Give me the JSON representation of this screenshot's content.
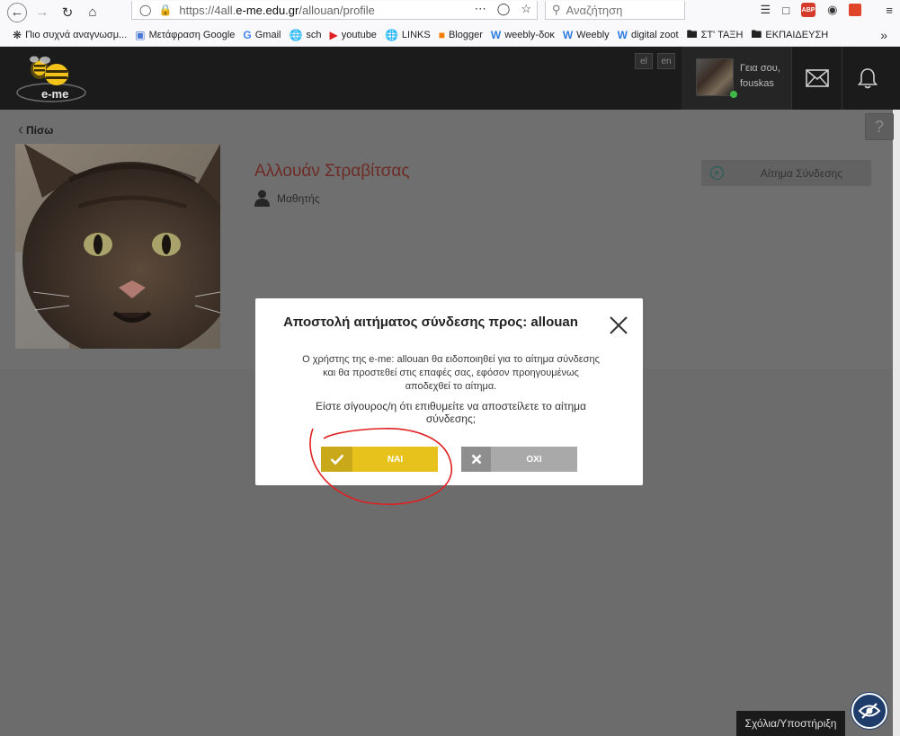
{
  "browser": {
    "url_prefix": "https://4all.",
    "url_domain": "e-me.edu.gr",
    "url_path": "/allouan/profile",
    "search_placeholder": "Αναζήτηση",
    "abp_label": "ABP"
  },
  "bookmarks": [
    {
      "label": "Πιο συχνά αναγνωσμ...",
      "icon": "gear-icon"
    },
    {
      "label": "Μετάφραση Google",
      "icon": "translate-icon"
    },
    {
      "label": "Gmail",
      "icon": "google-icon"
    },
    {
      "label": "sch",
      "icon": "globe-icon"
    },
    {
      "label": "youtube",
      "icon": "youtube-icon"
    },
    {
      "label": "LINKS",
      "icon": "globe-icon"
    },
    {
      "label": "Blogger",
      "icon": "blogger-icon"
    },
    {
      "label": "weebly-δοκ",
      "icon": "weebly-icon"
    },
    {
      "label": "Weebly",
      "icon": "weebly-icon"
    },
    {
      "label": "digital zoot",
      "icon": "weebly-icon"
    },
    {
      "label": "ΣΤ' ΤΑΞΗ",
      "icon": "folder-icon"
    },
    {
      "label": "ΕΚΠΑΙΔΕΥΣΗ",
      "icon": "folder-icon"
    }
  ],
  "header": {
    "logo_text": "e-me",
    "lang_el": "el",
    "lang_en": "en",
    "greeting": "Γεια σου,",
    "username": "fouskas"
  },
  "profile": {
    "back_label": "Πίσω",
    "help_label": "?",
    "name": "Αλλουάν Στραβίτσας",
    "role": "Μαθητής",
    "connect_label": "Αίτημα Σύνδεσης"
  },
  "modal": {
    "title": "Αποστολή αιτήματος σύνδεσης προς: allouan",
    "text_line1": "Ο χρήστης της e-me: allouan θα ειδοποιηθεί για το αίτημα σύνδεσης",
    "text_line2": "και θα προστεθεί στις επαφές σας, εφόσον προηγουμένως",
    "text_line3": "αποδεχθεί το αίτημα.",
    "question_line1": "Είστε σίγουρος/η ότι επιθυμείτε να αποστείλετε το αίτημα",
    "question_line2": "σύνδεσης;",
    "yes_label": "ΝΑΙ",
    "no_label": "ΟΧΙ"
  },
  "footer": {
    "feedback_label": "Σχόλια/Υποστήριξη"
  },
  "colors": {
    "yes_button": "#e8c21c",
    "no_button": "#a9a9a9",
    "profile_name": "#6e2b25",
    "annotation": "#e02020"
  }
}
